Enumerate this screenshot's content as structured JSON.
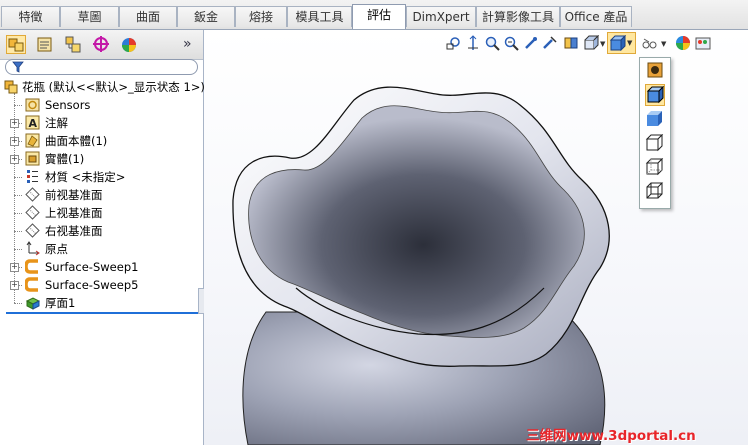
{
  "tabs": [
    "特徵",
    "草圖",
    "曲面",
    "鈑金",
    "熔接",
    "模具工具",
    "評估",
    "DimXpert",
    "計算影像工具",
    "Office 產品"
  ],
  "active_tab": "評估",
  "panel_tabs": [
    "feature-manager-icon",
    "property-manager-icon",
    "configuration-manager-icon",
    "dimxpert-manager-icon",
    "display-manager-icon"
  ],
  "panel_overflow": "»",
  "tree": {
    "root": "花瓶 (默认<<默认>_显示状态 1>)",
    "items": [
      {
        "label": "Sensors",
        "icon": "sensors-icon",
        "expandable": false
      },
      {
        "label": "注解",
        "icon": "annotations-icon",
        "expandable": true
      },
      {
        "label": "曲面本體(1)",
        "icon": "surface-bodies-icon",
        "expandable": true
      },
      {
        "label": "實體(1)",
        "icon": "solid-bodies-icon",
        "expandable": true
      },
      {
        "label": "材質 <未指定>",
        "icon": "material-icon",
        "expandable": false
      },
      {
        "label": "前视基准面",
        "icon": "plane-icon",
        "expandable": false
      },
      {
        "label": "上视基准面",
        "icon": "plane-icon",
        "expandable": false
      },
      {
        "label": "右视基准面",
        "icon": "plane-icon",
        "expandable": false
      },
      {
        "label": "原点",
        "icon": "origin-icon",
        "expandable": false
      },
      {
        "label": "Surface-Sweep1",
        "icon": "sweep-icon",
        "expandable": true
      },
      {
        "label": "Surface-Sweep5",
        "icon": "sweep-icon",
        "expandable": true
      },
      {
        "label": "厚面1",
        "icon": "thicken-icon",
        "expandable": false
      }
    ]
  },
  "view_toolbar": [
    "zoom-to-fit-icon",
    "zoom-to-area-icon",
    "zoom-in-out-icon",
    "zoom-to-selection-icon",
    "rotate-icon",
    "pan-icon",
    "section-view-icon",
    "view-orientation-icon",
    "display-style-icon",
    "hide-show-icon",
    "appearance-icon",
    "scene-icon"
  ],
  "display_style_options": [
    "realview-icon",
    "shaded-with-edges-icon",
    "shaded-icon",
    "hidden-lines-removed-icon",
    "hidden-lines-visible-icon",
    "wireframe-icon"
  ],
  "watermark": "三维网www.3dportal.cn",
  "colors": {
    "accent": "#e0a93a",
    "model_light": "#f4f5fa",
    "model_dark": "#3a3d4a",
    "watermark": "#e8252a"
  }
}
